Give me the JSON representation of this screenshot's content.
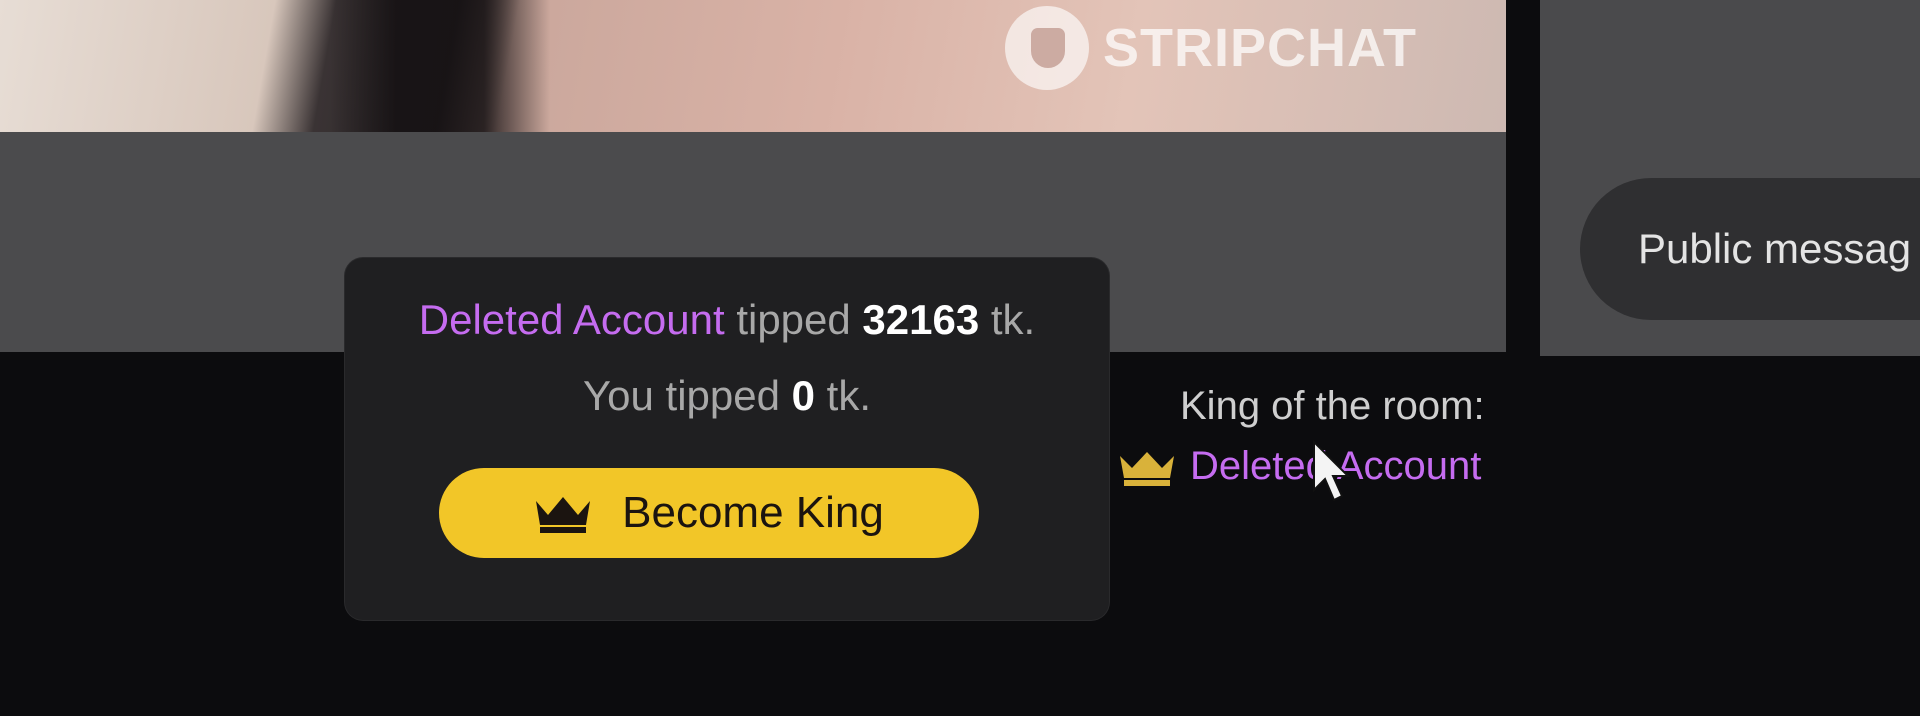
{
  "watermark": {
    "brand": "STRIPCHAT",
    "icon": "stripchat-logo-icon"
  },
  "tip_popup": {
    "top_tipper_name": "Deleted Account",
    "top_tipper_verb": "tipped",
    "top_tipper_amount": "32163",
    "unit": "tk.",
    "you_tipped_label": "You tipped",
    "you_tipped_amount": "0",
    "button_label": "Become King",
    "button_icon": "crown-icon"
  },
  "king_of_room": {
    "label": "King of the room:",
    "user": "Deleted Account",
    "icon": "crown-icon"
  },
  "chat": {
    "input_placeholder": "Public messag"
  },
  "colors": {
    "accent_purple": "#c56cf0",
    "button_yellow": "#f2c628",
    "crown_gold": "#d9b23a"
  }
}
